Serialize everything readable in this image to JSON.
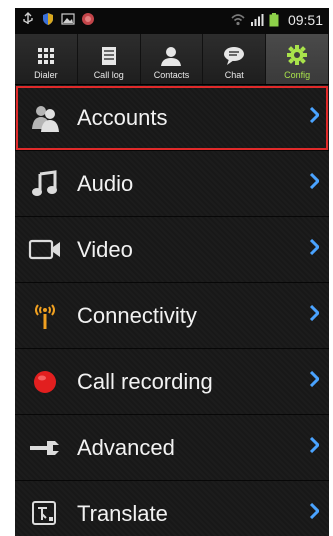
{
  "status": {
    "time": "09:51"
  },
  "tabs": [
    {
      "label": "Dialer",
      "icon": "dialpad-icon"
    },
    {
      "label": "Call log",
      "icon": "call-log-icon"
    },
    {
      "label": "Contacts",
      "icon": "contacts-icon"
    },
    {
      "label": "Chat",
      "icon": "chat-icon"
    },
    {
      "label": "Config",
      "icon": "gear-icon",
      "active": true
    }
  ],
  "menu": {
    "items": [
      {
        "label": "Accounts",
        "icon": "accounts-icon",
        "selected": true
      },
      {
        "label": "Audio",
        "icon": "music-note-icon"
      },
      {
        "label": "Video",
        "icon": "video-camera-icon"
      },
      {
        "label": "Connectivity",
        "icon": "antenna-icon"
      },
      {
        "label": "Call recording",
        "icon": "record-dot-icon"
      },
      {
        "label": "Advanced",
        "icon": "wrench-icon"
      },
      {
        "label": "Translate",
        "icon": "translate-icon"
      }
    ]
  },
  "colors": {
    "accent_green": "#a9e34b",
    "selection_red": "#e02a2a",
    "chevron_blue": "#4aa3ff"
  }
}
